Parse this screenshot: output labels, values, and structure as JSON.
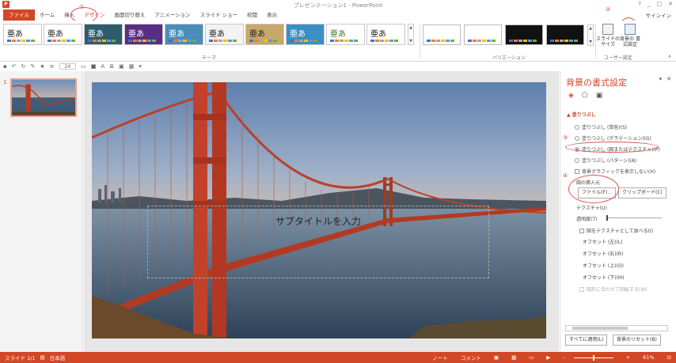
{
  "window": {
    "title": "プレゼンテーション1 - PowerPoint",
    "help": "?",
    "minimize": "_",
    "maximize": "□",
    "close": "✕"
  },
  "tabs": [
    {
      "label": "ファイル"
    },
    {
      "label": "ホーム"
    },
    {
      "label": "挿入"
    },
    {
      "label": "デザイン"
    },
    {
      "label": "画面切り替え"
    },
    {
      "label": "アニメーション"
    },
    {
      "label": "スライド ショー"
    },
    {
      "label": "校閲"
    },
    {
      "label": "表示"
    }
  ],
  "signin": "サインイン",
  "annotations": {
    "n1": "①",
    "n2": "②",
    "n3": "③",
    "n4": "④"
  },
  "ribbon": {
    "themes": [
      {
        "sample": "亜あ",
        "bg": "#ffffff",
        "fg": "#222222"
      },
      {
        "sample": "亜あ",
        "bg": "#ffffff",
        "fg": "#222222"
      },
      {
        "sample": "亜あ",
        "bg": "#2e5c6e",
        "fg": "#ffffff"
      },
      {
        "sample": "亜あ",
        "bg": "#5a2d82",
        "fg": "#ffffff"
      },
      {
        "sample": "亜あ",
        "bg": "#4b8db8",
        "fg": "#ffffff"
      },
      {
        "sample": "亜あ",
        "bg": "#f3f3f3",
        "fg": "#222222"
      },
      {
        "sample": "亜あ",
        "bg": "#c9a76a",
        "fg": "#222222"
      },
      {
        "sample": "亜あ",
        "bg": "#3b8fc4",
        "fg": "#ffffff"
      },
      {
        "sample": "亜あ",
        "bg": "#ffffff",
        "fg": "#3f7a2a"
      },
      {
        "sample": "亜あ",
        "bg": "#ffffff",
        "fg": "#222222"
      }
    ],
    "themes_group_label": "テーマ",
    "variants": [
      {
        "bg": "#ffffff"
      },
      {
        "bg": "#ffffff"
      },
      {
        "bg": "#111111"
      },
      {
        "bg": "#111111"
      }
    ],
    "variants_group_label": "バリエーション",
    "slide_size_label": "スライドの サイズ",
    "format_background_label": "背景の 書式設定",
    "user_settings_group_label": "ユーザー設定"
  },
  "qat": {
    "font_size": "24"
  },
  "thumbnails": {
    "slide_number": "1"
  },
  "slide": {
    "subtitle_placeholder": "サブタイトルを入力"
  },
  "pane": {
    "title": "背景の書式設定",
    "collapse": "▾",
    "close": "✕",
    "section_fill": "▲ 塗りつぶし",
    "fill_solid": "塗りつぶし (単色)(S)",
    "fill_gradient": "塗りつぶし (グラデーション)(G)",
    "fill_picture": "塗りつぶし (図またはテクスチャ)(P)",
    "fill_pattern": "塗りつぶし (パターン)(A)",
    "hide_background_graphics": "背景グラフィックを表示しない(H)",
    "insert_picture_from": "図の挿入元",
    "file_button": "ファイル(F)...",
    "clipboard_button": "クリップボード(C)",
    "texture_label": "テクスチャ(U)",
    "transparency_label": "透明度(T)",
    "tile_checkbox": "図をテクスチャとして並べる(I)",
    "offset_left": "オフセット (左)(L)",
    "offset_right": "オフセット (右)(R)",
    "offset_top": "オフセット (上)(O)",
    "offset_bottom": "オフセット (下)(M)",
    "rotate_with_shape": "図形に合わせて回転する(W)",
    "apply_all_button": "すべてに適用(L)",
    "reset_background_button": "背景のリセット(B)"
  },
  "status": {
    "slide_info": "スライド 1/1",
    "language": "日本語",
    "notes": "ノート",
    "comments": "コメント",
    "zoom_minus": "–",
    "zoom_plus": "+",
    "zoom": "61%"
  },
  "colors": {
    "accent": "#d24726",
    "annotation": "#e03030"
  }
}
